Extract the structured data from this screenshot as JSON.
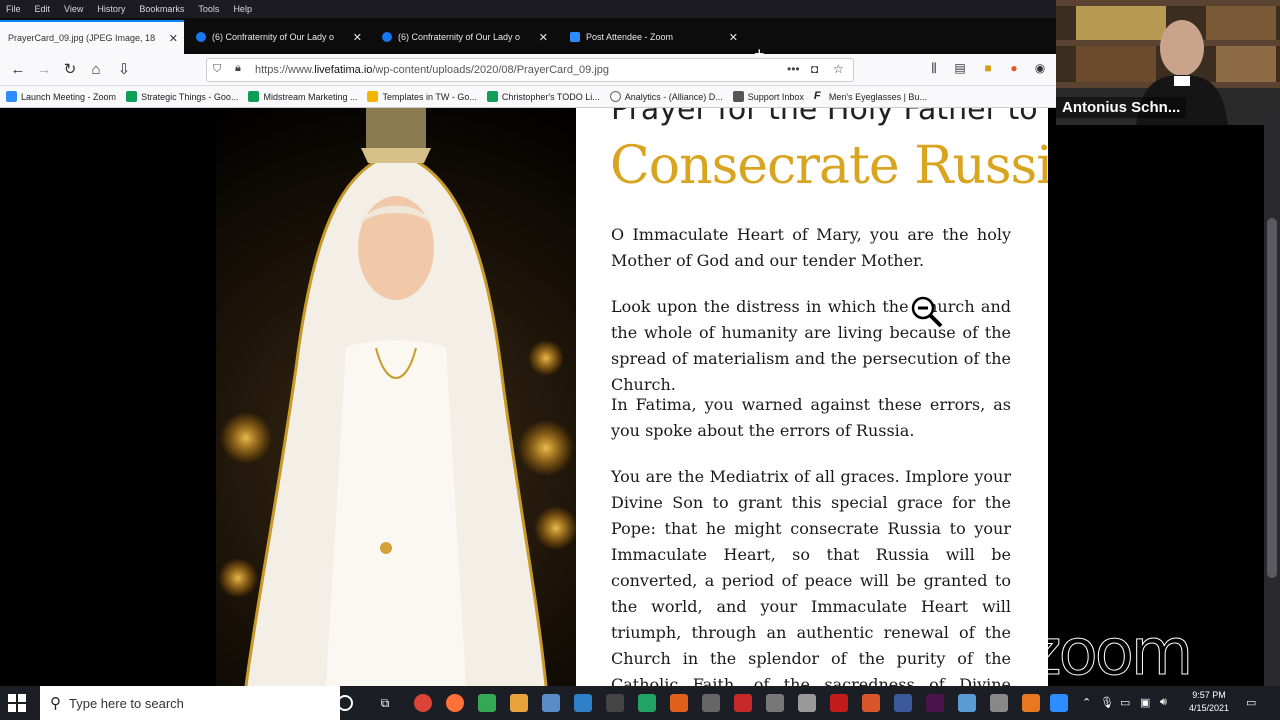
{
  "menubar": {
    "items": [
      "File",
      "Edit",
      "View",
      "History",
      "Bookmarks",
      "Tools",
      "Help"
    ]
  },
  "tabs": [
    {
      "label": "PrayerCard_09.jpg (JPEG Image, 18",
      "active": true,
      "icon": "image-icon"
    },
    {
      "label": "(6) Confraternity of Our Lady o",
      "active": false,
      "icon": "facebook-icon"
    },
    {
      "label": "(6) Confraternity of Our Lady o",
      "active": false,
      "icon": "facebook-icon"
    },
    {
      "label": "Post Attendee - Zoom",
      "active": false,
      "icon": "zoom-icon"
    }
  ],
  "url": {
    "prefix": "https://www.",
    "domain": "livefatima.io",
    "path": "/wp-content/uploads/2020/08/PrayerCard_09.jpg"
  },
  "bookmarks": [
    {
      "label": "Launch Meeting - Zoom",
      "color": "#2d8cff"
    },
    {
      "label": "Strategic Things - Goo...",
      "color": "#0f9d58"
    },
    {
      "label": "Midstream Marketing ...",
      "color": "#0f9d58"
    },
    {
      "label": "Templates in TW - Go...",
      "color": "#f4b400"
    },
    {
      "label": "Christopher's TODO Li...",
      "color": "#0f9d58"
    },
    {
      "label": "Analytics - (Alliance) D...",
      "color": "#888888"
    },
    {
      "label": "Support Inbox",
      "color": "#555555"
    },
    {
      "label": "Men's Eyeglasses | Bu...",
      "color": "#222222"
    }
  ],
  "card": {
    "title_line1": "Prayer for the Holy Father to",
    "title_line2": "Consecrate Russia",
    "paragraphs": [
      "O Immaculate Heart of Mary, you are the holy Mother of God and our tender Mother.",
      "Look upon the distress in which the Church and the whole of humanity are living because of the spread of materialism and the persecution of the Church.",
      "In Fatima, you warned against these errors, as you spoke about the errors of Russia.",
      "You are the Mediatrix of all graces. Implore your Divine Son to grant this special grace for the Pope: that he might consecrate Russia to your Immaculate Heart, so that Russia will be converted, a period of peace will be granted to the world, and your Immaculate Heart will triumph, through an authentic renewal of the Church in the splendor of the purity of the Catholic Faith, of the sacredness of Divine worship and of the holiness of the Christian life."
    ]
  },
  "zoom": {
    "participant_name": "Antonius Schn...",
    "logo_text": "zoom"
  },
  "taskbar": {
    "search_placeholder": "Type here to search",
    "time": "9:57 PM",
    "date": "4/15/2021"
  },
  "colors": {
    "accent": "#0a84ff",
    "title_gold": "#d9a520"
  }
}
